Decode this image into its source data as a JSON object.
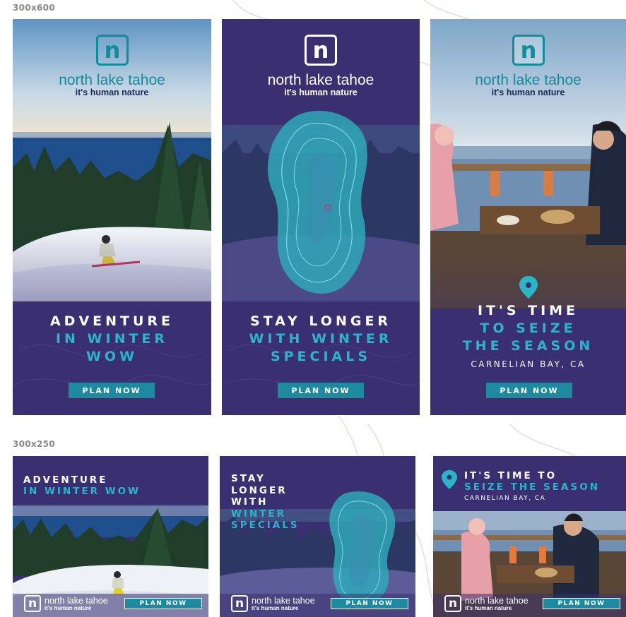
{
  "sections": {
    "tall": "300x600",
    "medium": "300x250"
  },
  "brand": {
    "logo_letter": "n",
    "name": "north lake tahoe",
    "tagline": "it's human nature"
  },
  "colors": {
    "navy": "#3a2f70",
    "teal": "#2ab6c8",
    "cta": "#1d8aa0",
    "logo_teal": "#0f8d9a"
  },
  "ads_tall": [
    {
      "id": "adventure",
      "headline": [
        "ADVENTURE"
      ],
      "headline_teal": [
        "IN WINTER",
        "WOW"
      ],
      "cta": "PLAN NOW"
    },
    {
      "id": "stay",
      "headline": [
        "STAY LONGER"
      ],
      "headline_teal": [
        "WITH WINTER",
        "SPECIALS"
      ],
      "cta": "PLAN NOW"
    },
    {
      "id": "time",
      "headline": [
        "IT'S TIME"
      ],
      "headline_teal": [
        "TO SEIZE",
        "THE SEASON"
      ],
      "subline": "CARNELIAN BAY, CA",
      "cta": "PLAN NOW",
      "icon": "map-pin-icon"
    }
  ],
  "ads_medium": [
    {
      "id": "adventure",
      "headline": [
        "ADVENTURE"
      ],
      "headline_teal": [
        "IN WINTER WOW"
      ],
      "cta": "PLAN NOW"
    },
    {
      "id": "stay",
      "headline": [
        "STAY",
        "LONGER",
        "WITH"
      ],
      "headline_teal": [
        "WINTER",
        "SPECIALS"
      ],
      "cta": "PLAN NOW"
    },
    {
      "id": "time",
      "headline": [
        "IT'S TIME TO"
      ],
      "headline_teal": [
        "SEIZE THE SEASON"
      ],
      "subline": "CARNELIAN BAY, CA",
      "cta": "PLAN NOW",
      "icon": "map-pin-icon"
    }
  ]
}
